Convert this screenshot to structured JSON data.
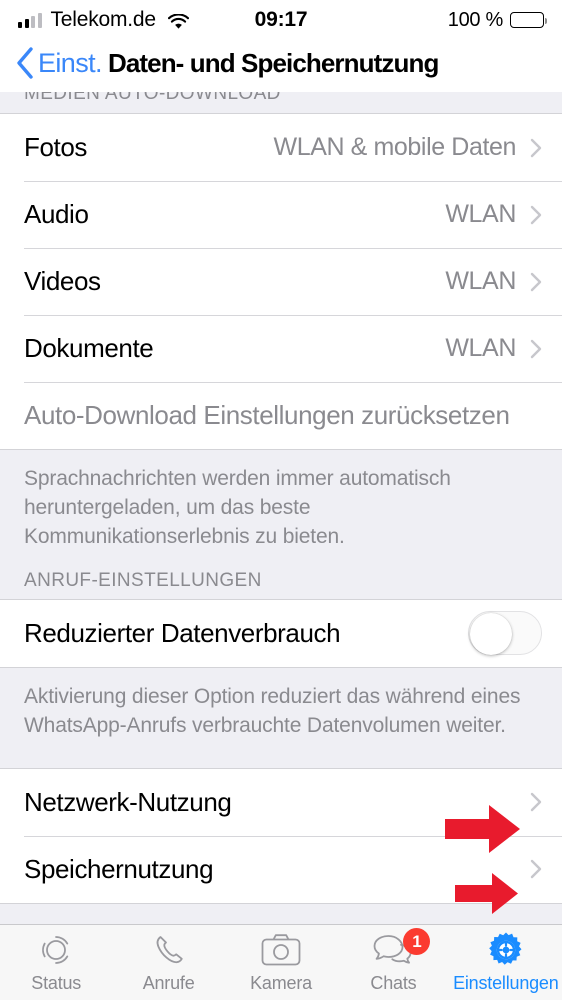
{
  "status_bar": {
    "carrier": "Telekom.de",
    "time": "09:17",
    "battery_text": "100 %",
    "signal_icon": "signal-bars-icon",
    "wifi_icon": "wifi-icon",
    "battery_icon": "battery-full-icon"
  },
  "nav": {
    "back_label": "Einst.",
    "back_icon": "chevron-left-icon",
    "title": "Daten- und Speichernutzung",
    "accent_color": "#3A87F9"
  },
  "sections": {
    "media": {
      "header": "MEDIEN AUTO-DOWNLOAD",
      "rows": [
        {
          "label": "Fotos",
          "value": "WLAN & mobile Daten"
        },
        {
          "label": "Audio",
          "value": "WLAN"
        },
        {
          "label": "Videos",
          "value": "WLAN"
        },
        {
          "label": "Dokumente",
          "value": "WLAN"
        }
      ],
      "reset_label": "Auto-Download Einstellungen zurücksetzen",
      "footnote": "Sprachnachrichten werden immer automatisch heruntergeladen, um das beste Kommunikationserlebnis zu bieten."
    },
    "calls": {
      "header": "ANRUF-EINSTELLUNGEN",
      "toggle_label": "Reduzierter Datenverbrauch",
      "toggle_state": "off",
      "footnote": "Aktivierung dieser Option reduziert das während eines WhatsApp-Anrufs verbrauchte Datenvolumen weiter."
    },
    "usage": {
      "rows": [
        {
          "label": "Netzwerk-Nutzung"
        },
        {
          "label": "Speichernutzung"
        }
      ]
    }
  },
  "annotations": {
    "arrow_color": "#E81B2D",
    "arrows": [
      {
        "target": "Netzwerk-Nutzung"
      },
      {
        "target": "Speichernutzung"
      }
    ]
  },
  "tabbar": {
    "active": "Einstellungen",
    "active_color": "#1A8CFF",
    "badge_color": "#FB3B30",
    "tabs": [
      {
        "label": "Status",
        "icon": "status-rings-icon",
        "badge": ""
      },
      {
        "label": "Anrufe",
        "icon": "phone-icon",
        "badge": ""
      },
      {
        "label": "Kamera",
        "icon": "camera-icon",
        "badge": ""
      },
      {
        "label": "Chats",
        "icon": "chat-bubbles-icon",
        "badge": "1"
      },
      {
        "label": "Einstellungen",
        "icon": "gear-icon",
        "badge": ""
      }
    ]
  }
}
